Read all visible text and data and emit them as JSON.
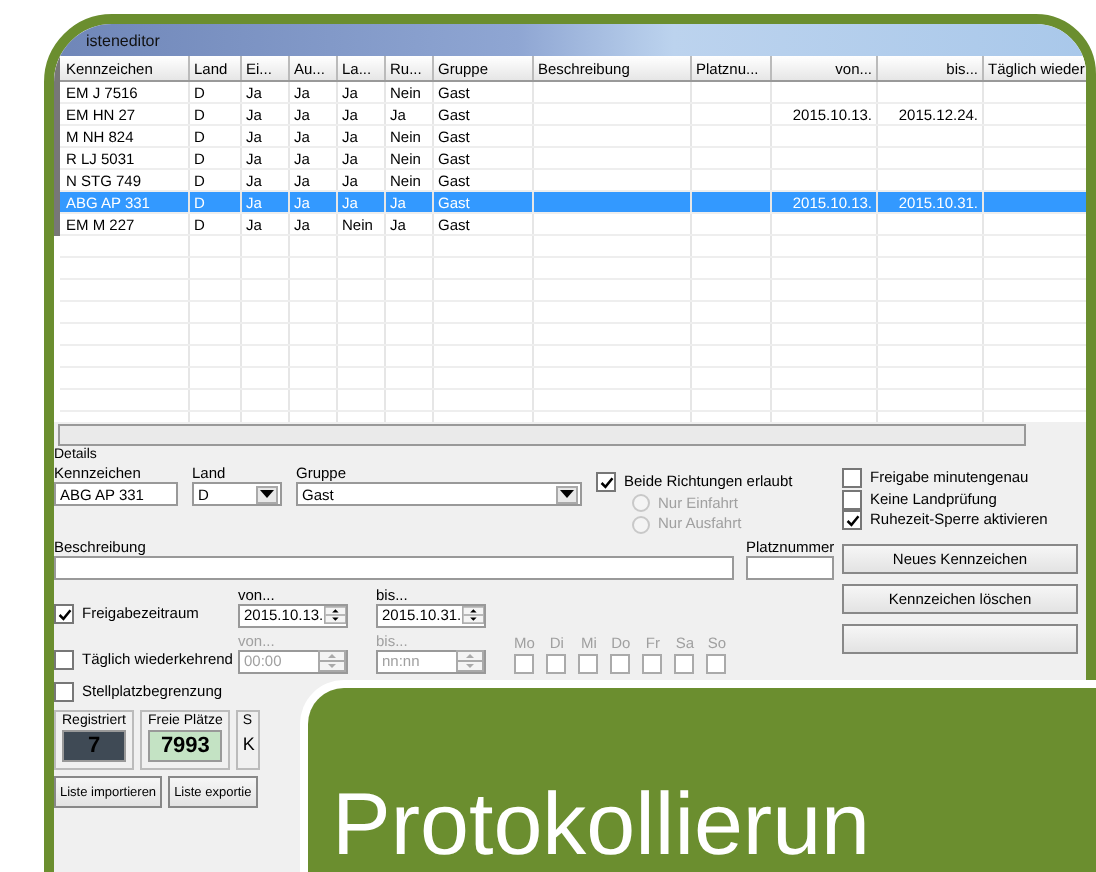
{
  "window": {
    "title": "isteneditor"
  },
  "table": {
    "columns": [
      "Kennzeichen",
      "Land",
      "Ei...",
      "Au...",
      "La...",
      "Ru...",
      "Gruppe",
      "Beschreibung",
      "Platznu...",
      "von...",
      "bis...",
      "Täglich wieder"
    ],
    "rows": [
      {
        "selected": false,
        "cells": [
          "EM J 7516",
          "D",
          "Ja",
          "Ja",
          "Ja",
          "Nein",
          "Gast",
          "",
          "",
          "",
          "",
          ""
        ]
      },
      {
        "selected": false,
        "cells": [
          "EM HN 27",
          "D",
          "Ja",
          "Ja",
          "Ja",
          "Ja",
          "Gast",
          "",
          "",
          "2015.10.13.",
          "2015.12.24.",
          ""
        ]
      },
      {
        "selected": false,
        "cells": [
          "M NH 824",
          "D",
          "Ja",
          "Ja",
          "Ja",
          "Nein",
          "Gast",
          "",
          "",
          "",
          "",
          ""
        ]
      },
      {
        "selected": false,
        "cells": [
          "R LJ 5031",
          "D",
          "Ja",
          "Ja",
          "Ja",
          "Nein",
          "Gast",
          "",
          "",
          "",
          "",
          ""
        ]
      },
      {
        "selected": false,
        "cells": [
          "N STG 749",
          "D",
          "Ja",
          "Ja",
          "Ja",
          "Nein",
          "Gast",
          "",
          "",
          "",
          "",
          ""
        ]
      },
      {
        "selected": true,
        "cells": [
          "ABG AP 331",
          "D",
          "Ja",
          "Ja",
          "Ja",
          "Ja",
          "Gast",
          "",
          "",
          "2015.10.13.",
          "2015.10.31.",
          ""
        ]
      },
      {
        "selected": false,
        "cells": [
          "EM M 227",
          "D",
          "Ja",
          "Ja",
          "Nein",
          "Ja",
          "Gast",
          "",
          "",
          "",
          "",
          ""
        ]
      }
    ]
  },
  "details": {
    "title": "Details",
    "plate": {
      "label": "Kennzeichen",
      "value": "ABG AP 331"
    },
    "country": {
      "label": "Land",
      "value": "D"
    },
    "group": {
      "label": "Gruppe",
      "value": "Gast"
    },
    "both_directions": {
      "label": "Beide Richtungen erlaubt",
      "checked": true
    },
    "direction_options": [
      {
        "label": "Nur Einfahrt",
        "selected": false,
        "disabled": true
      },
      {
        "label": "Nur Ausfahrt",
        "selected": false,
        "disabled": true
      }
    ],
    "options": [
      {
        "label": "Freigabe minutengenau",
        "checked": false
      },
      {
        "label": "Keine Landprüfung",
        "checked": false
      },
      {
        "label": "Ruhezeit-Sperre aktivieren",
        "checked": true
      }
    ],
    "description": {
      "label": "Beschreibung"
    },
    "space_number": {
      "label": "Platznummer"
    },
    "actions": [
      {
        "label": "Neues Kennzeichen"
      },
      {
        "label": "Kennzeichen löschen"
      }
    ],
    "release_period": {
      "label": "Freigabezeitraum",
      "checked": true,
      "from_label": "von...",
      "from": "2015.10.13.",
      "to_label": "bis...",
      "to": "2015.10.31."
    },
    "daily": {
      "label": "Täglich wiederkehrend",
      "checked": false,
      "disabled": true,
      "from_label": "von...",
      "from": "00:00",
      "to_label": "bis...",
      "to": "nn:nn",
      "days": [
        {
          "label": "Mo",
          "checked": false
        },
        {
          "label": "Di",
          "checked": false
        },
        {
          "label": "Mi",
          "checked": false
        },
        {
          "label": "Do",
          "checked": false
        },
        {
          "label": "Fr",
          "checked": false
        },
        {
          "label": "Sa",
          "checked": false
        },
        {
          "label": "So",
          "checked": false
        }
      ]
    },
    "space_limit": {
      "label": "Stellplatzbegrenzung",
      "checked": false
    }
  },
  "counters": [
    {
      "label": "Registriert",
      "value": "7",
      "kind": "dark"
    },
    {
      "label": "Freie Plätze",
      "value": "7993",
      "kind": "free"
    },
    {
      "label": "S",
      "value": "K",
      "kind": "plain"
    }
  ],
  "footer_buttons": [
    {
      "label": "Liste importieren"
    },
    {
      "label": "Liste exportie"
    }
  ],
  "banner": {
    "text": "Protokollierun"
  }
}
